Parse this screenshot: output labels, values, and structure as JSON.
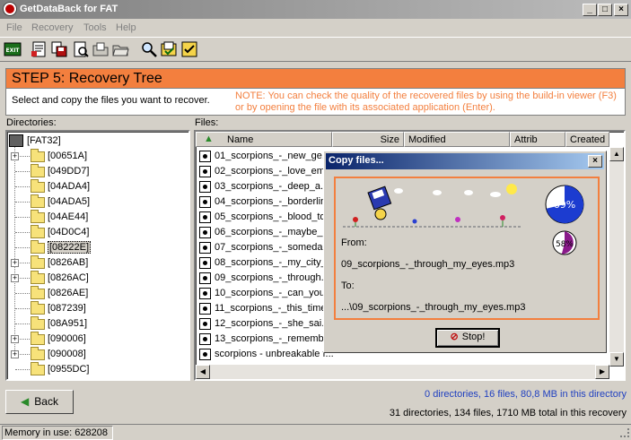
{
  "window": {
    "title": "GetDataBack for FAT"
  },
  "menu": [
    "File",
    "Recovery",
    "Tools",
    "Help"
  ],
  "toolbar": {
    "exit_label": "EXIT"
  },
  "step": {
    "title": "STEP 5: Recovery Tree",
    "instruction": "Select and copy the files you want to recover.",
    "note": "NOTE: You can check the quality of the recovered files by using the build-in viewer (F3) or by opening the file with its associated application (Enter)."
  },
  "directories": {
    "label": "Directories:",
    "items": [
      {
        "name": "[FAT32]",
        "expandable": false
      },
      {
        "name": "[00651A]",
        "expandable": true
      },
      {
        "name": "[049DD7]",
        "expandable": false
      },
      {
        "name": "[04ADA4]",
        "expandable": false
      },
      {
        "name": "[04ADA5]",
        "expandable": false
      },
      {
        "name": "[04AE44]",
        "expandable": false
      },
      {
        "name": "[04D0C4]",
        "expandable": false
      },
      {
        "name": "[08222E]",
        "expandable": false,
        "selected": true
      },
      {
        "name": "[0826AB]",
        "expandable": true
      },
      {
        "name": "[0826AC]",
        "expandable": true
      },
      {
        "name": "[0826AE]",
        "expandable": false
      },
      {
        "name": "[087239]",
        "expandable": false
      },
      {
        "name": "[08A951]",
        "expandable": false
      },
      {
        "name": "[090006]",
        "expandable": true
      },
      {
        "name": "[090008]",
        "expandable": true
      },
      {
        "name": "[0955DC]",
        "expandable": false
      }
    ]
  },
  "files": {
    "label": "Files:",
    "columns": [
      "Name",
      "Size",
      "Modified",
      "Attrib",
      "Created"
    ],
    "rows": [
      "01_scorpions_-_new_ge...",
      "02_scorpions_-_love_em...",
      "03_scorpions_-_deep_a...",
      "04_scorpions_-_borderlin...",
      "05_scorpions_-_blood_to...",
      "06_scorpions_-_maybe_i...",
      "07_scorpions_-_someda...",
      "08_scorpions_-_my_city_...",
      "09_scorpions_-_through...",
      "10_scorpions_-_can_you...",
      "11_scorpions_-_this_time...",
      "12_scorpions_-_she_sai...",
      "13_scorpions_-_rememb...",
      "scorpions - unbreakable f..."
    ]
  },
  "dialog": {
    "title": "Copy files...",
    "progress_total": "69%",
    "progress_file": "58%",
    "from_label": "From:",
    "from_value": "09_scorpions_-_through_my_eyes.mp3",
    "to_label": "To:",
    "to_value": "...\\09_scorpions_-_through_my_eyes.mp3",
    "stop_label": "Stop!"
  },
  "bottom": {
    "back_label": "Back",
    "summary_dir": "0 directories, 16 files, 80,8 MB in this directory",
    "summary_total": "31 directories, 134 files, 1710 MB total in this recovery"
  },
  "status": {
    "memory": "Memory in use: 628208"
  },
  "colors": {
    "accent": "#f37f3e",
    "link": "#2040c0",
    "title_active": "#0a246a"
  }
}
